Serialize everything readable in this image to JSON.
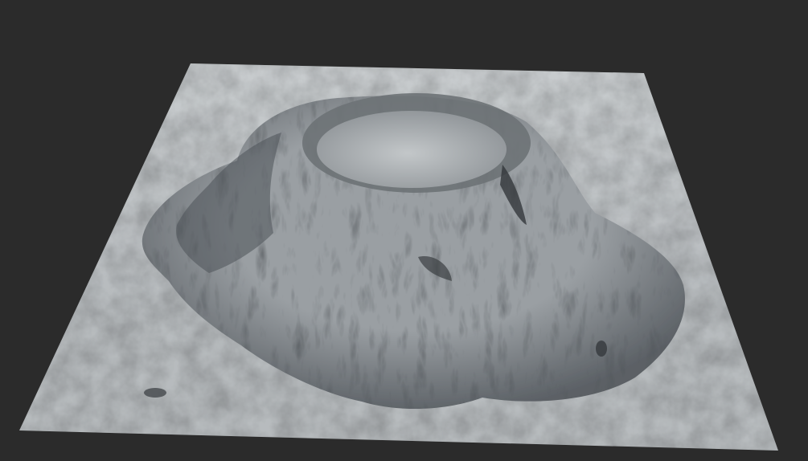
{
  "viewport": {
    "background_color": "#2b2b2b"
  },
  "terrain": {
    "subject": "mountain-with-crater",
    "plane_color": "#b7bbbe",
    "plane_light_color": "#c8ccce",
    "plane_shadow_color": "#8e9397",
    "mountain_mid_color": "#9a9fa3",
    "mountain_dark_color": "#5b6065",
    "crater_floor_color": "#c3c7c9"
  }
}
